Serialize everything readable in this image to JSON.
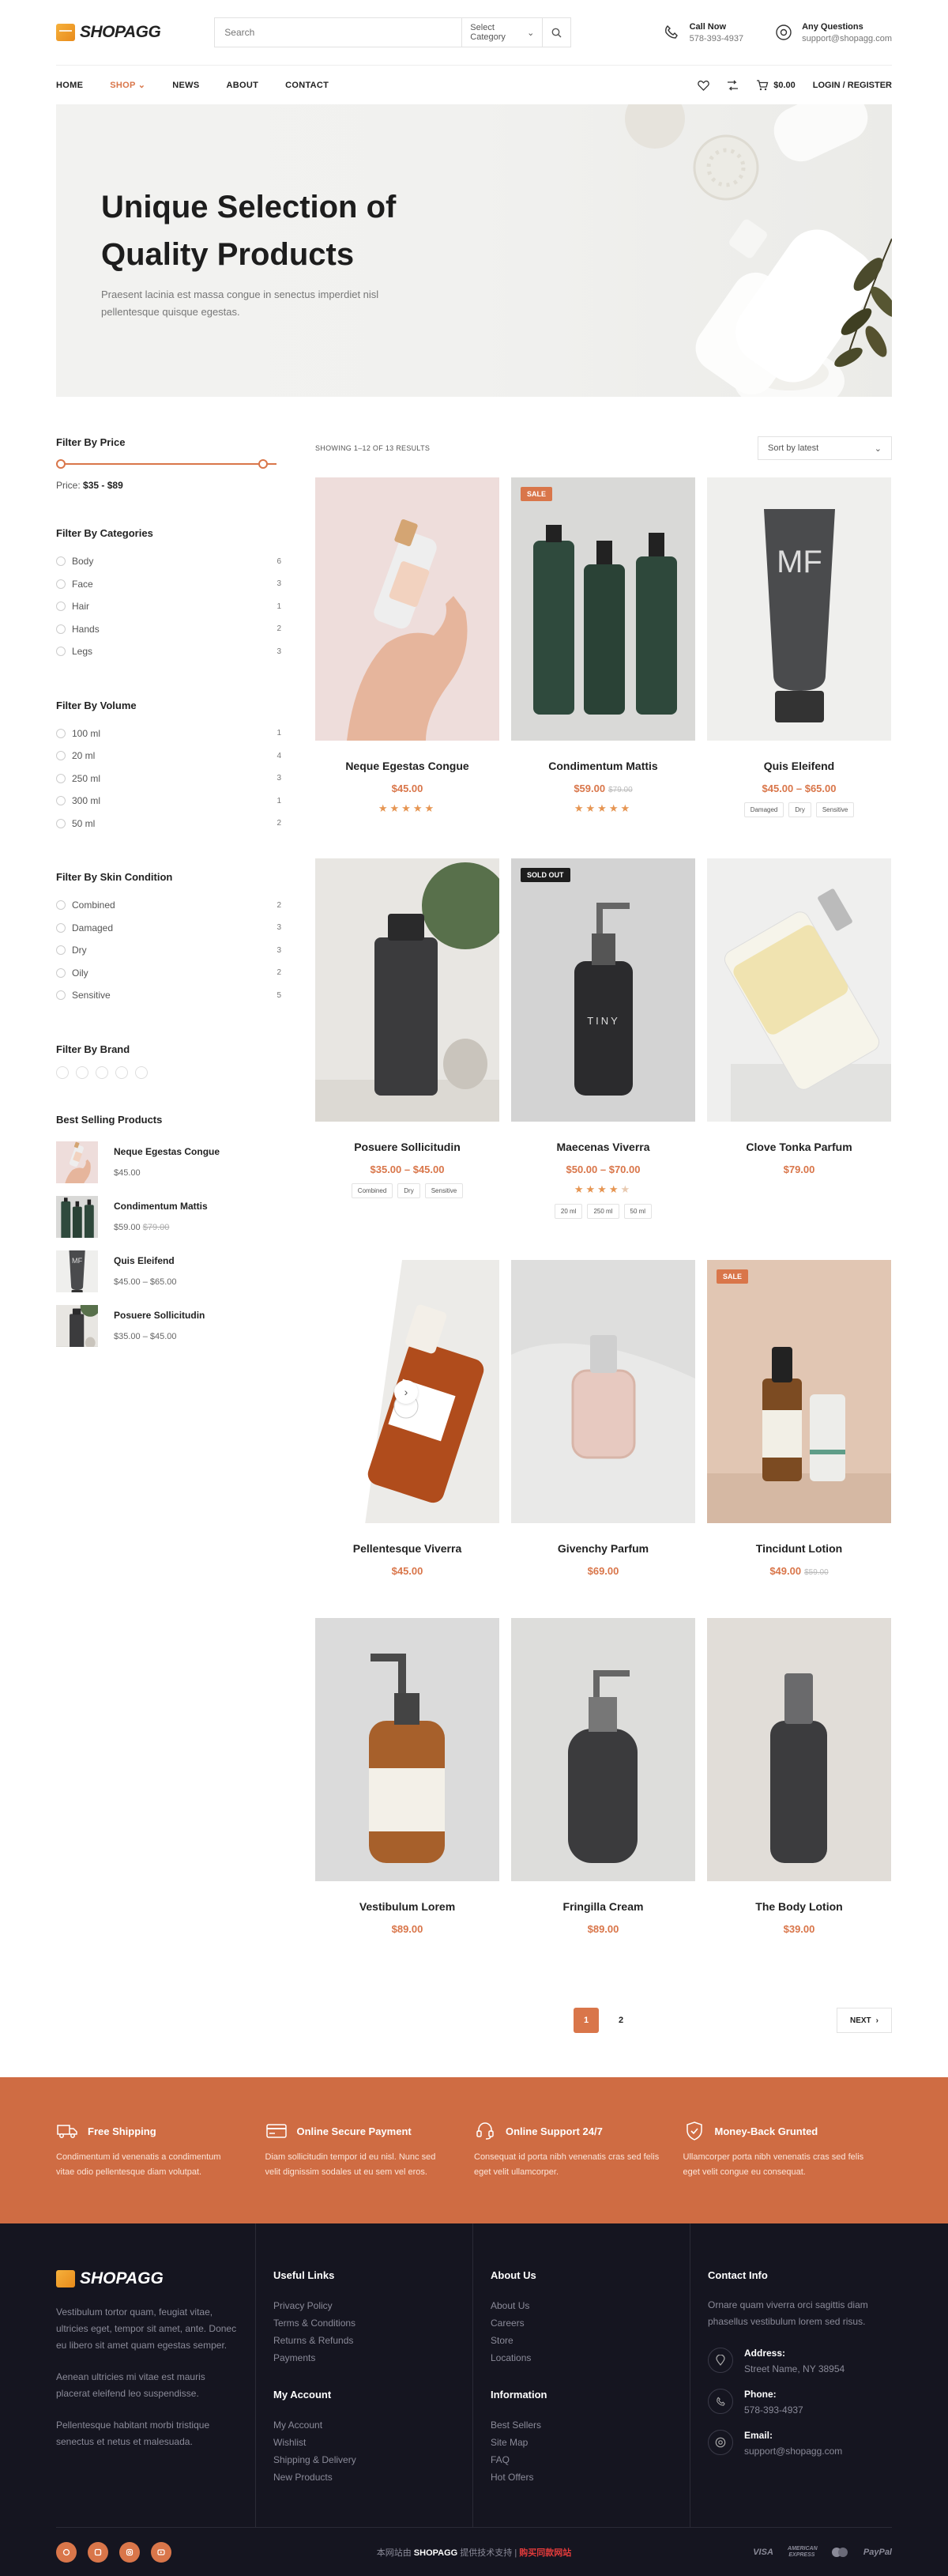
{
  "brand": {
    "name": "SHOPAGG"
  },
  "search": {
    "placeholder": "Search",
    "category": "Select Category"
  },
  "contact": {
    "call_title": "Call Now",
    "call_value": "578-393-4937",
    "q_title": "Any Questions",
    "q_value": "support@shopagg.com"
  },
  "nav": {
    "items": [
      "HOME",
      "SHOP",
      "NEWS",
      "ABOUT",
      "CONTACT"
    ],
    "cart": "$0.00",
    "login": "LOGIN / REGISTER"
  },
  "hero": {
    "title": "Unique Selection of Quality Products",
    "text": "Praesent lacinia est massa congue in senectus imperdiet nisl pellentesque quisque egestas."
  },
  "filters": {
    "price": {
      "title": "Filter By Price",
      "label": "Price:",
      "range": "$35 - $89",
      "min_fraction": 0,
      "max_fraction": 1
    },
    "categories": {
      "title": "Filter By Categories",
      "items": [
        {
          "label": "Body",
          "count": "6"
        },
        {
          "label": "Face",
          "count": "3"
        },
        {
          "label": "Hair",
          "count": "1"
        },
        {
          "label": "Hands",
          "count": "2"
        },
        {
          "label": "Legs",
          "count": "3"
        }
      ]
    },
    "volume": {
      "title": "Filter By Volume",
      "items": [
        {
          "label": "100 ml",
          "count": "1"
        },
        {
          "label": "20 ml",
          "count": "4"
        },
        {
          "label": "250 ml",
          "count": "3"
        },
        {
          "label": "300 ml",
          "count": "1"
        },
        {
          "label": "50 ml",
          "count": "2"
        }
      ]
    },
    "skin": {
      "title": "Filter By Skin Condition",
      "items": [
        {
          "label": "Combined",
          "count": "2"
        },
        {
          "label": "Damaged",
          "count": "3"
        },
        {
          "label": "Dry",
          "count": "3"
        },
        {
          "label": "Oily",
          "count": "2"
        },
        {
          "label": "Sensitive",
          "count": "5"
        }
      ]
    },
    "brand": {
      "title": "Filter By Brand"
    }
  },
  "best_selling": {
    "title": "Best Selling Products",
    "items": [
      {
        "name": "Neque Egestas Congue",
        "price": "$45.00",
        "old": ""
      },
      {
        "name": "Condimentum Mattis",
        "price": "$59.00",
        "old": "$79.00"
      },
      {
        "name": "Quis Eleifend",
        "price": "$45.00 – $65.00",
        "old": ""
      },
      {
        "name": "Posuere Sollicitudin",
        "price": "$35.00 – $45.00",
        "old": ""
      }
    ]
  },
  "toolbar": {
    "results": "SHOWING 1–12 OF 13 RESULTS",
    "sort": "Sort by latest"
  },
  "products": [
    {
      "name": "Neque Egestas Congue",
      "price": "$45.00",
      "old": "",
      "badge": "",
      "rating": 5,
      "tags": []
    },
    {
      "name": "Condimentum Mattis",
      "price": "$59.00",
      "old": "$79.00",
      "badge": "SALE",
      "rating": 5,
      "tags": []
    },
    {
      "name": "Quis Eleifend",
      "price": "$45.00 – $65.00",
      "old": "",
      "badge": "",
      "rating": 0,
      "tags": [
        "Damaged",
        "Dry",
        "Sensitive"
      ]
    },
    {
      "name": "Posuere Sollicitudin",
      "price": "$35.00 – $45.00",
      "old": "",
      "badge": "",
      "rating": 0,
      "tags": [
        "Combined",
        "Dry",
        "Sensitive"
      ]
    },
    {
      "name": "Maecenas Viverra",
      "price": "$50.00 – $70.00",
      "old": "",
      "badge": "SOLD OUT",
      "rating": 4.5,
      "tags": [
        "20 ml",
        "250 ml",
        "50 ml"
      ]
    },
    {
      "name": "Clove Tonka Parfum",
      "price": "$79.00",
      "old": "",
      "badge": "",
      "rating": 0,
      "tags": []
    },
    {
      "name": "Pellentesque Viverra",
      "price": "$45.00",
      "old": "",
      "badge": "",
      "rating": 0,
      "tags": []
    },
    {
      "name": "Givenchy Parfum",
      "price": "$69.00",
      "old": "",
      "badge": "",
      "rating": 0,
      "tags": []
    },
    {
      "name": "Tincidunt Lotion",
      "price": "$49.00",
      "old": "$59.00",
      "badge": "SALE",
      "rating": 0,
      "tags": []
    },
    {
      "name": "Vestibulum Lorem",
      "price": "$89.00",
      "old": "",
      "badge": "",
      "rating": 0,
      "tags": []
    },
    {
      "name": "Fringilla Cream",
      "price": "$89.00",
      "old": "",
      "badge": "",
      "rating": 0,
      "tags": []
    },
    {
      "name": "The Body Lotion",
      "price": "$39.00",
      "old": "",
      "badge": "",
      "rating": 0,
      "tags": []
    }
  ],
  "pagination": {
    "pages": [
      "1",
      "2"
    ],
    "next": "NEXT"
  },
  "features": [
    {
      "title": "Free Shipping",
      "text": "Condimentum id venenatis a condimentum vitae odio pellentesque diam volutpat.",
      "icon": "truck-icon"
    },
    {
      "title": "Online Secure Payment",
      "text": "Diam sollicitudin tempor id eu nisl. Nunc sed velit dignissim sodales ut eu sem vel eros.",
      "icon": "card-icon"
    },
    {
      "title": "Online Support 24/7",
      "text": "Consequat id porta nibh venenatis cras sed felis eget velit ullamcorper.",
      "icon": "headset-icon"
    },
    {
      "title": "Money-Back Grunted",
      "text": "Ullamcorper porta nibh venenatis cras sed felis eget velit congue eu consequat.",
      "icon": "shield-icon"
    }
  ],
  "footer": {
    "about": [
      "Vestibulum tortor quam, feugiat vitae, ultricies eget, tempor sit amet, ante. Donec eu libero sit amet quam egestas semper.",
      "Aenean ultricies mi vitae est mauris placerat eleifend leo suspendisse.",
      "Pellentesque habitant morbi tristique senectus et netus et malesuada."
    ],
    "useful": {
      "title": "Useful Links",
      "links": [
        "Privacy Policy",
        "Terms & Conditions",
        "Returns & Refunds",
        "Payments"
      ]
    },
    "account": {
      "title": "My Account",
      "links": [
        "My Account",
        "Wishlist",
        "Shipping & Delivery",
        "New Products"
      ]
    },
    "about_us": {
      "title": "About Us",
      "links": [
        "About Us",
        "Careers",
        "Store",
        "Locations"
      ]
    },
    "information": {
      "title": "Information",
      "links": [
        "Best Sellers",
        "Site Map",
        "FAQ",
        "Hot Offers"
      ]
    },
    "contact": {
      "title": "Contact Info",
      "text": "Ornare quam viverra orci sagittis diam phasellus vestibulum lorem sed risus.",
      "address_label": "Address:",
      "address": "Street Name, NY 38954",
      "phone_label": "Phone:",
      "phone": "578-393-4937",
      "email_label": "Email:",
      "email": "support@shopagg.com"
    },
    "copy_prefix": "本网站由",
    "copy_brand": "SHOPAGG",
    "copy_mid": "提供技术支持 |",
    "copy_red": "购买同款网站",
    "payments": [
      "VISA",
      "AMERICAN EXPRESS",
      "mastercard",
      "PayPal"
    ]
  },
  "colors": {
    "accent": "#d9764a",
    "features_bg": "#cf6c43",
    "footer_bg": "#151520"
  }
}
